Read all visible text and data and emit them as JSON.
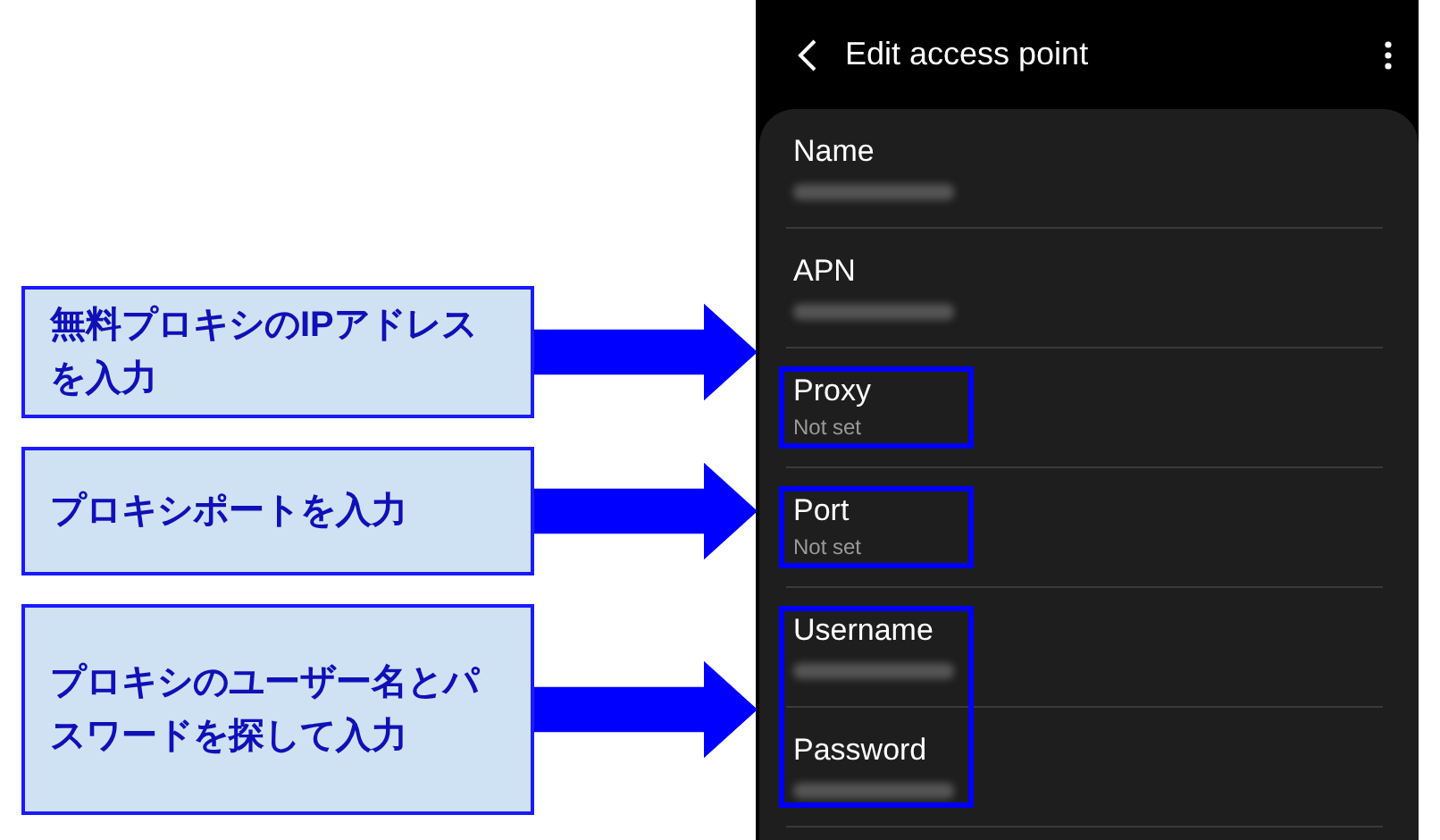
{
  "callouts": [
    {
      "text": "無料プロキシのIPアドレスを入力"
    },
    {
      "text": "プロキシポートを入力"
    },
    {
      "text": "プロキシのユーザー名とパスワードを探して入力"
    }
  ],
  "screen": {
    "title": "Edit access point",
    "sections": [
      {
        "highlighted": false,
        "fields": [
          {
            "label": "Name",
            "kind": "blurred"
          }
        ]
      },
      {
        "highlighted": false,
        "fields": [
          {
            "label": "APN",
            "kind": "blurred"
          }
        ]
      },
      {
        "highlighted": true,
        "fields": [
          {
            "label": "Proxy",
            "kind": "text",
            "value": "Not set"
          }
        ]
      },
      {
        "highlighted": true,
        "fields": [
          {
            "label": "Port",
            "kind": "text",
            "value": "Not set"
          }
        ]
      },
      {
        "highlighted": true,
        "fields": [
          {
            "label": "Username",
            "kind": "blurred"
          },
          {
            "label": "Password",
            "kind": "blurred"
          }
        ]
      }
    ]
  }
}
